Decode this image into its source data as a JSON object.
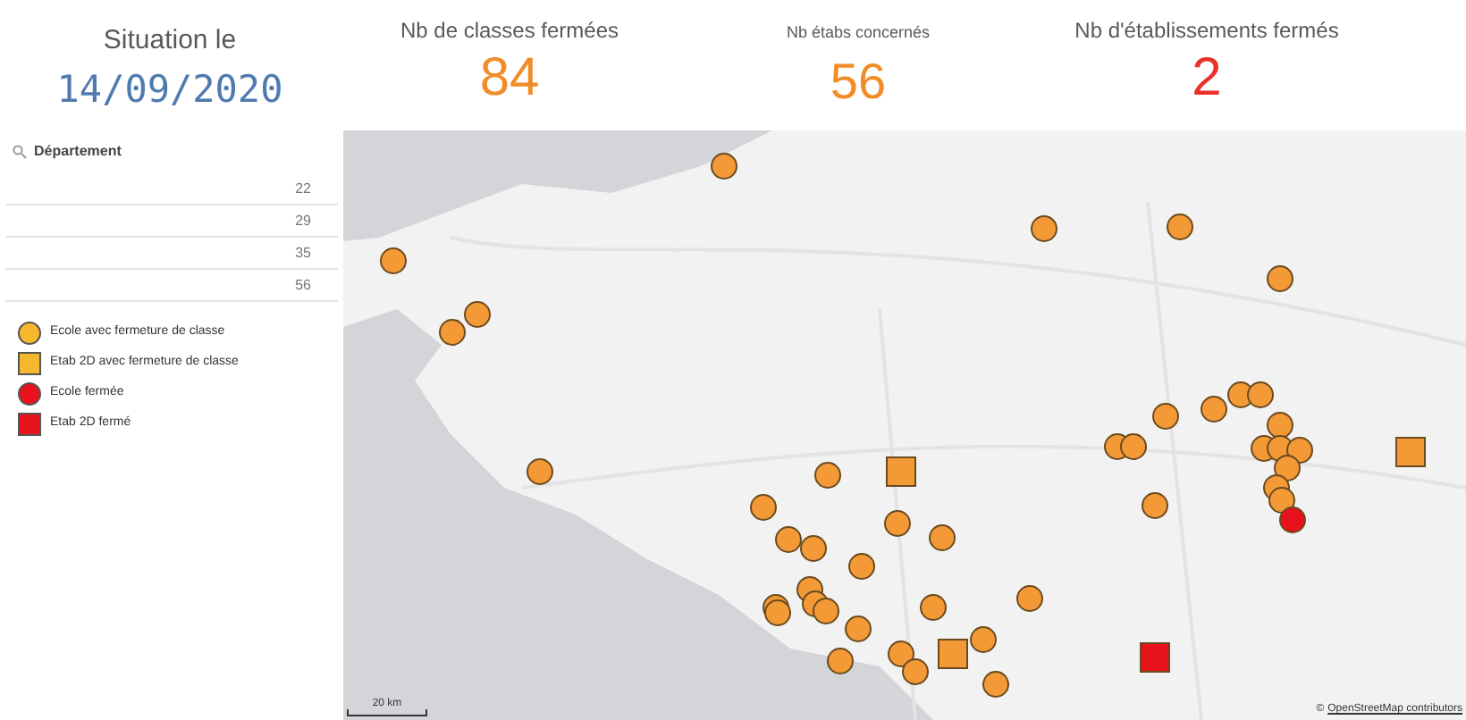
{
  "kpis": [
    {
      "label": "Situation le",
      "value": "14/09/2020",
      "kind": "date"
    },
    {
      "label": "Nb de classes fermées",
      "value": "84",
      "kind": "count",
      "color": "#f28c28"
    },
    {
      "label": "Nb étabs concernés",
      "value": "56",
      "kind": "count-small",
      "color": "#f28c28"
    },
    {
      "label": "Nb d'établissements fermés",
      "value": "2",
      "kind": "count",
      "color": "#e8312a"
    }
  ],
  "filter": {
    "title": "Département",
    "items": [
      "22",
      "29",
      "35",
      "56"
    ]
  },
  "legend": [
    {
      "label": "Ecole avec fermeture de classe",
      "kind": "circle",
      "color": "#f5b82e"
    },
    {
      "label": "Etab 2D avec fermeture de classe",
      "kind": "square",
      "color": "#f5b82e"
    },
    {
      "label": "Ecole fermée",
      "kind": "circle",
      "color": "#e8121c"
    },
    {
      "label": "Etab 2D fermé",
      "kind": "square",
      "color": "#e8121c"
    }
  ],
  "map": {
    "scale": "20 km",
    "copyright": "©",
    "attribution": "OpenStreetMap contributors"
  }
}
